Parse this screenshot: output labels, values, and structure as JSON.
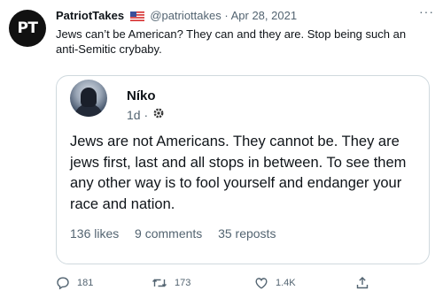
{
  "tweet": {
    "avatar_text": "PT",
    "author_name": "PatriotTakes",
    "handle": "@patriottakes",
    "separator": "·",
    "date": "Apr 28, 2021",
    "more": "···",
    "text": "Jews can’t be American? They can and they are. Stop being such an anti-Semitic crybaby."
  },
  "quote": {
    "author_name": "Níko",
    "time": "1d",
    "separator": "·",
    "text": "Jews are not Americans. They cannot be. They are jews first, last and all stops in between. To see them any other way is to fool yourself and endanger your race and nation.",
    "likes": "136 likes",
    "comments": "9 comments",
    "reposts": "35 reposts"
  },
  "actions": {
    "replies": "181",
    "retweets": "173",
    "likes": "1.4K"
  },
  "icons": [
    "us-flag-icon",
    "more-icon",
    "gear-icon",
    "reply-icon",
    "retweet-icon",
    "like-icon",
    "share-icon"
  ],
  "colors": {
    "text": "#0f1419",
    "muted": "#536471",
    "border": "#cfd9de"
  }
}
